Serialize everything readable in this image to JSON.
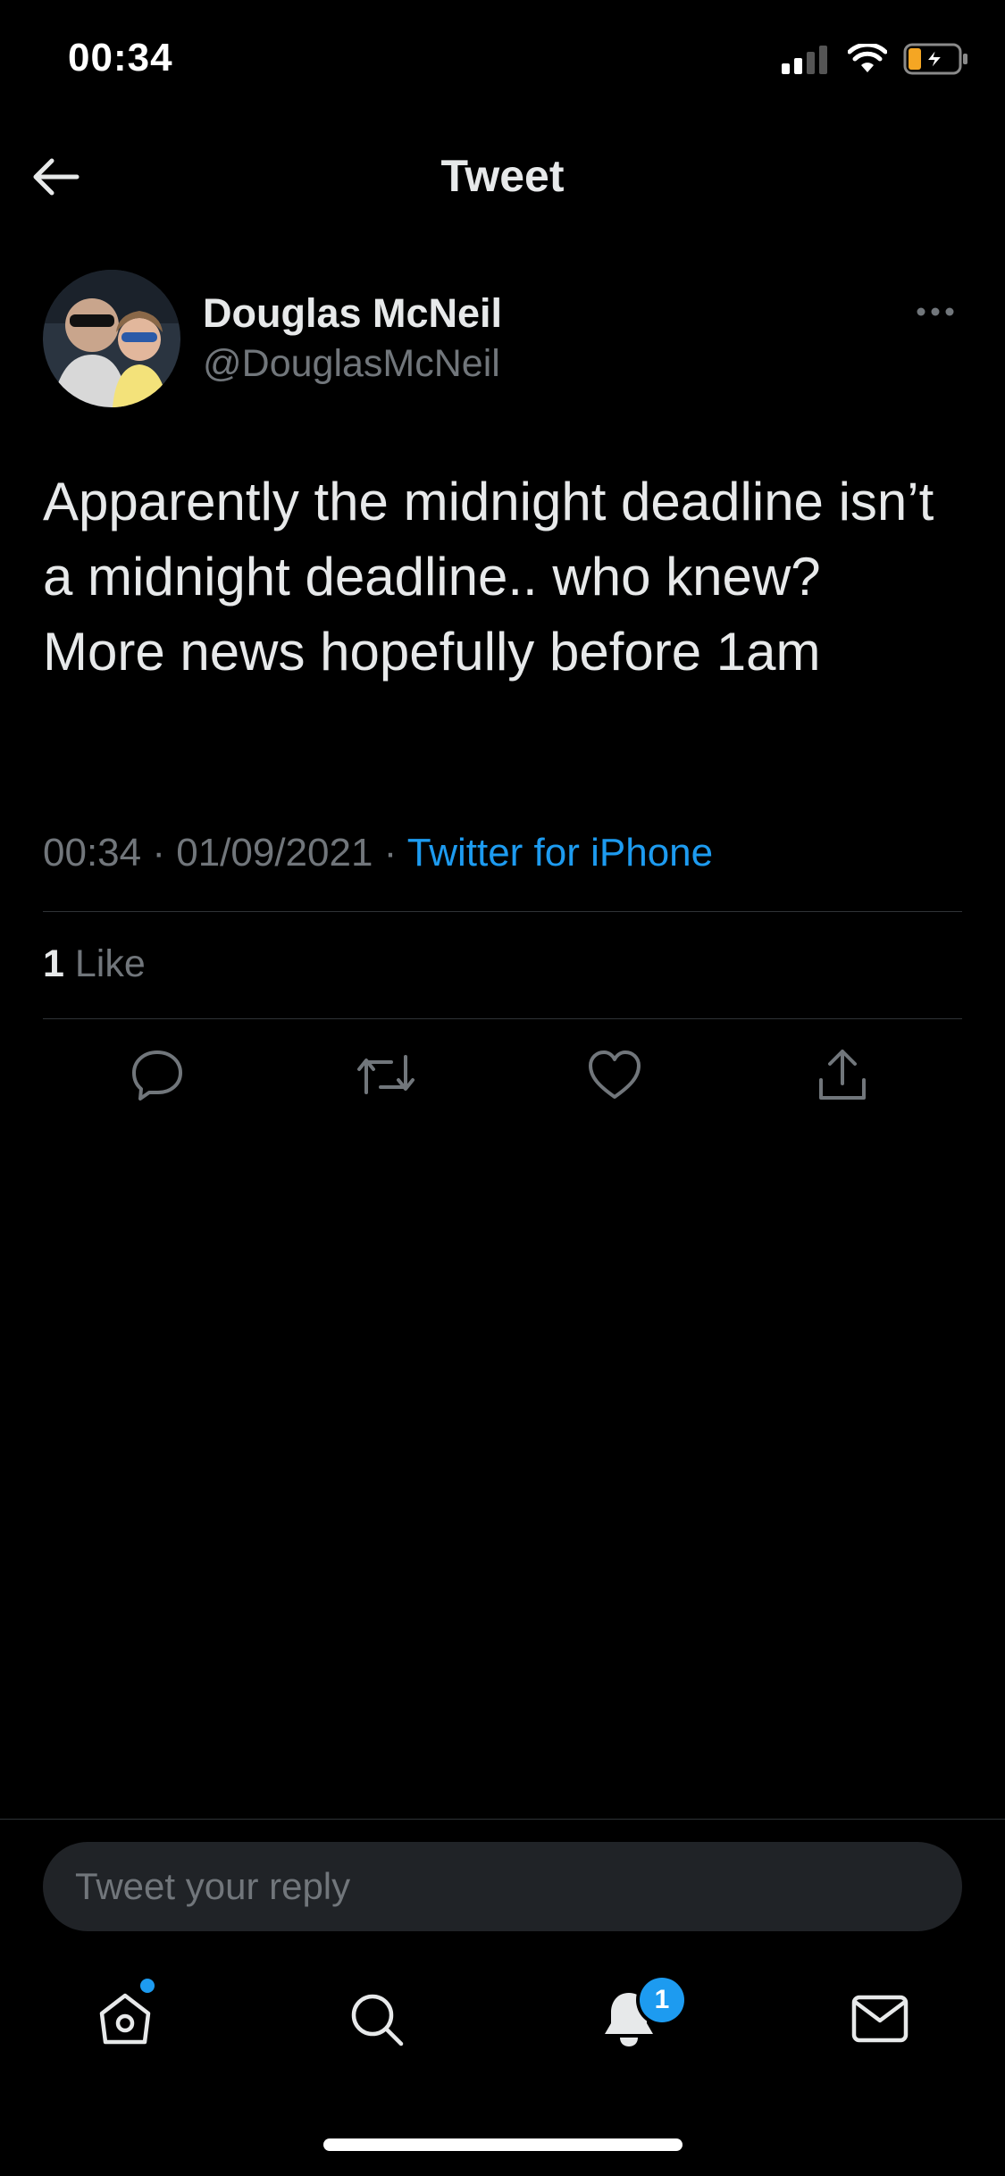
{
  "status_bar": {
    "time": "00:34",
    "icons": [
      "cellular-signal-icon",
      "wifi-icon",
      "battery-charging-icon"
    ]
  },
  "header": {
    "title": "Tweet",
    "back_icon": "arrow-left-icon"
  },
  "tweet": {
    "author": {
      "name": "Douglas McNeil",
      "handle": "@DouglasMcNeil"
    },
    "text": "Apparently the midnight deadline isn’t a midnight deadline.. who knew? More news hopefully before 1am",
    "time": "00:34",
    "separator": " · ",
    "date": "01/09/2021",
    "source": "Twitter for iPhone",
    "likes": {
      "count": "1",
      "label": " Like"
    },
    "actions": [
      "reply-icon",
      "retweet-icon",
      "like-icon",
      "share-icon"
    ]
  },
  "reply": {
    "placeholder": "Tweet your reply"
  },
  "tab_bar": {
    "tabs": [
      "home-icon",
      "search-icon",
      "notifications-icon",
      "messages-icon"
    ],
    "notifications_badge": "1"
  },
  "colors": {
    "background": "#000000",
    "text_primary": "#e7e9ea",
    "text_secondary": "#71767b",
    "accent": "#1d9bf0",
    "divider": "#2f3336",
    "input_bg": "#202327"
  }
}
